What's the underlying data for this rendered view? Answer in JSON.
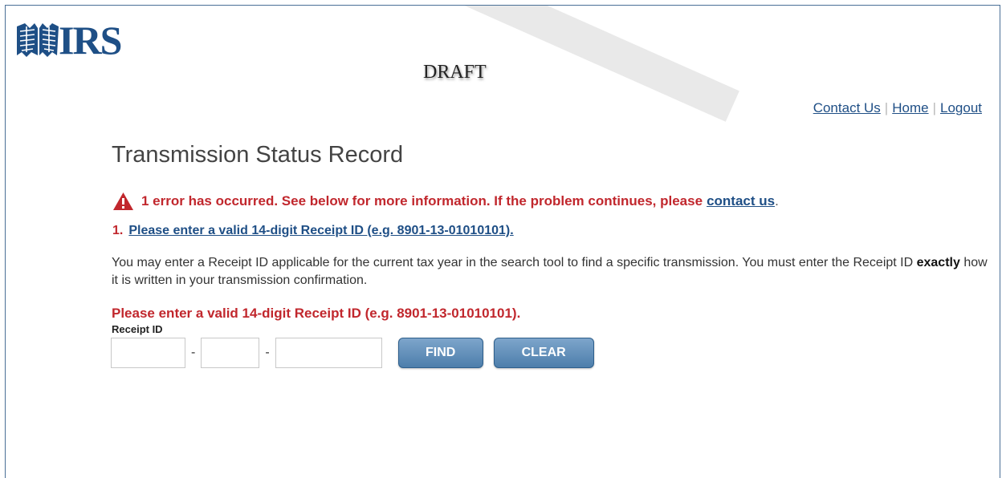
{
  "header": {
    "logo_text": "IRS",
    "watermark": "DRAFT"
  },
  "nav": {
    "contact": "Contact Us",
    "home": "Home",
    "logout": "Logout",
    "separator": "|"
  },
  "main": {
    "title": "Transmission Status Record",
    "error_summary": "1 error has occurred. See below for more information. If the problem continues, please",
    "error_contact_link": "contact us",
    "error_summary_end": ".",
    "error_item_number": "1.",
    "error_item_link": "Please enter a valid 14-digit Receipt ID (e.g. 8901-13-01010101).",
    "description_part1": "You may enter a Receipt ID applicable for the current tax year in the search tool to find a specific transmission. You must enter the Receipt ID",
    "description_bold": "exactly",
    "description_part2": "how it is written in your transmission confirmation.",
    "field_error": "Please enter a valid 14-digit Receipt ID (e.g. 8901-13-01010101).",
    "field_label": "Receipt ID",
    "input1_value": "",
    "input2_value": "",
    "input3_value": "",
    "dash": "-",
    "find_button": "FIND",
    "clear_button": "CLEAR"
  },
  "icons": {
    "logo": "irs-eagle-seal-icon",
    "warning": "warning-triangle-icon"
  },
  "colors": {
    "brand_blue": "#1e4f86",
    "error_red": "#c1272d",
    "button_blue": "#5a88b4"
  }
}
